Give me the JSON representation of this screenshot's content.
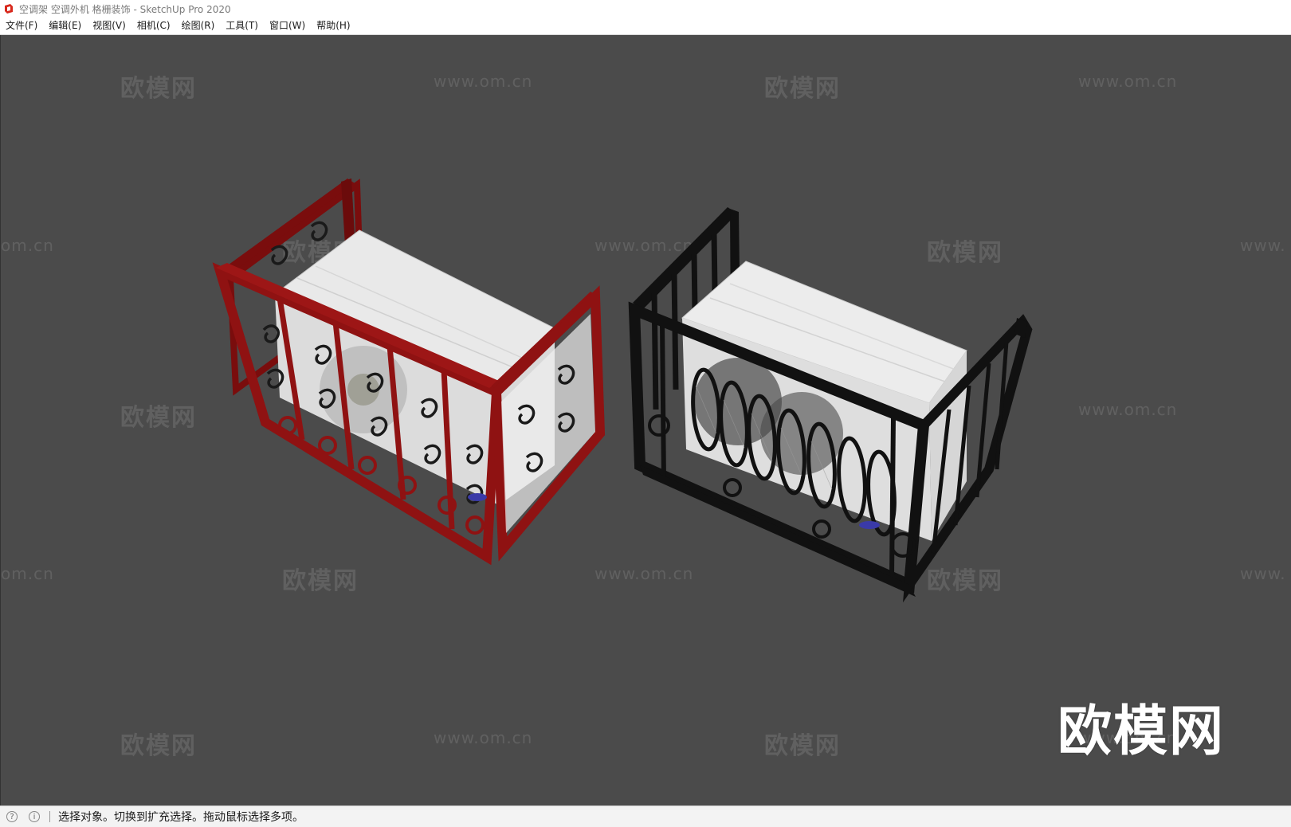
{
  "window": {
    "title": "空调架 空调外机 格栅装饰 - SketchUp Pro 2020"
  },
  "menu": {
    "items": [
      {
        "label": "文件(F)"
      },
      {
        "label": "编辑(E)"
      },
      {
        "label": "视图(V)"
      },
      {
        "label": "相机(C)"
      },
      {
        "label": "绘图(R)"
      },
      {
        "label": "工具(T)"
      },
      {
        "label": "窗口(W)"
      },
      {
        "label": "帮助(H)"
      }
    ]
  },
  "watermark": {
    "cn": "欧模网",
    "url": "www.om.cn",
    "url_fragment_left": "om.cn",
    "url_fragment_right": "www.",
    "logo": "欧模网"
  },
  "status": {
    "message": "选择对象。切换到扩充选择。拖动鼠标选择多项。",
    "icon_geo": "geo-location-icon",
    "icon_info": "info-icon"
  },
  "colors": {
    "viewport": "#4b4b4b",
    "red_cage": "#8f1212",
    "black_cage": "#111111",
    "unit_body": "#e8e8e8"
  }
}
